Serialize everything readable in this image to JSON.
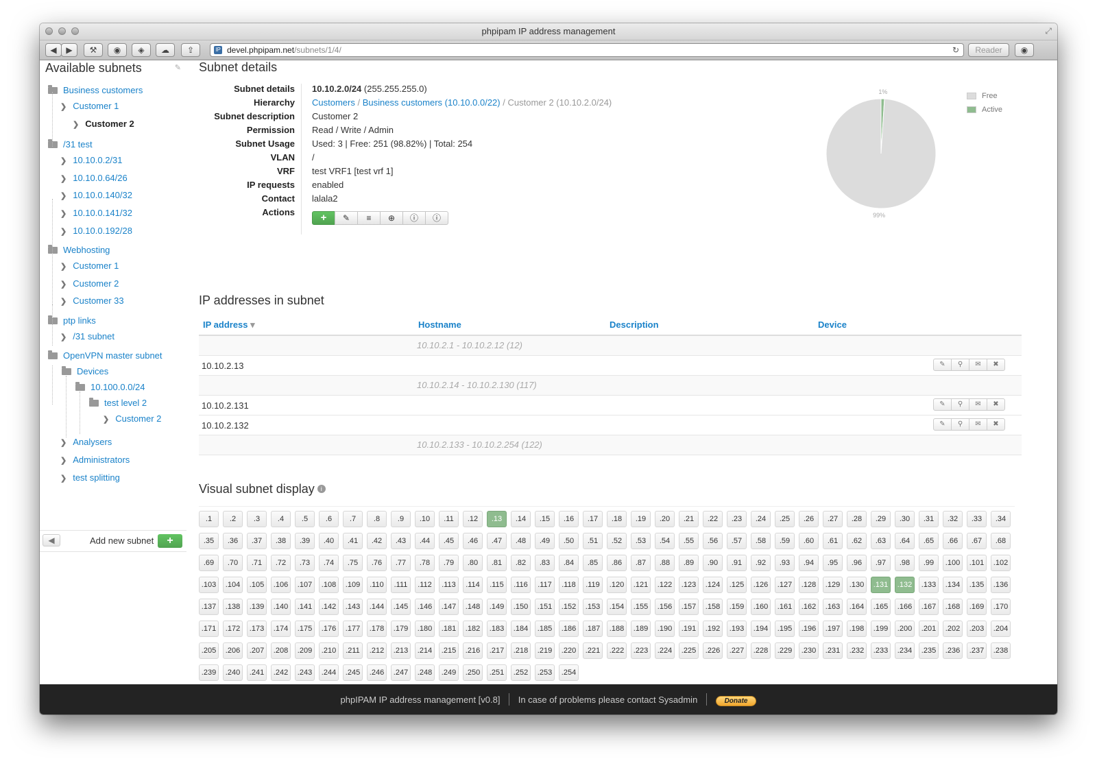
{
  "window": {
    "title": "phpipam IP address management"
  },
  "browser": {
    "url_host": "devel.phpipam.net",
    "url_path": "/subnets/1/4/",
    "reader_label": "Reader"
  },
  "sidebar": {
    "title": "Available subnets",
    "items": [
      {
        "label": "Business customers",
        "type": "folder"
      },
      {
        "label": "Customer 1",
        "type": "leaf"
      },
      {
        "label": "Customer 2",
        "type": "leaf",
        "active": true
      },
      {
        "label": "/31 test",
        "type": "folder"
      },
      {
        "label": "10.10.0.2/31",
        "type": "leaf"
      },
      {
        "label": "10.10.0.64/26",
        "type": "leaf"
      },
      {
        "label": "10.10.0.140/32",
        "type": "leaf"
      },
      {
        "label": "10.10.0.141/32",
        "type": "leaf"
      },
      {
        "label": "10.10.0.192/28",
        "type": "leaf"
      },
      {
        "label": "Webhosting",
        "type": "folder"
      },
      {
        "label": "Customer 1",
        "type": "leaf"
      },
      {
        "label": "Customer 2",
        "type": "leaf"
      },
      {
        "label": "Customer 33",
        "type": "leaf"
      },
      {
        "label": "ptp links",
        "type": "folder"
      },
      {
        "label": "/31 subnet",
        "type": "leaf"
      },
      {
        "label": "OpenVPN master subnet",
        "type": "folder"
      },
      {
        "label": "Devices",
        "type": "folder"
      },
      {
        "label": "10.100.0.0/24",
        "type": "folder"
      },
      {
        "label": "test level 2",
        "type": "folder"
      },
      {
        "label": "Customer 2",
        "type": "leaf"
      },
      {
        "label": "Analysers",
        "type": "leaf"
      },
      {
        "label": "Administrators",
        "type": "leaf"
      },
      {
        "label": "test splitting",
        "type": "leaf"
      }
    ],
    "add_label": "Add new subnet",
    "add_icon": "+"
  },
  "details": {
    "title": "Subnet details",
    "subnet_key": "Subnet details",
    "subnet_value_bold": "10.10.2.0/24",
    "subnet_value_mask": "(255.255.255.0)",
    "hierarchy_key": "Hierarchy",
    "hierarchy": [
      "Customers",
      "Business customers (10.10.0.0/22)",
      "Customer 2 (10.10.2.0/24)"
    ],
    "hierarchy_sep": "/",
    "rows": [
      {
        "key": "Subnet description",
        "value": "Customer 2"
      },
      {
        "key": "Permission",
        "value": "Read / Write / Admin"
      },
      {
        "key": "Subnet Usage",
        "value": "Used: 3 | Free: 251 (98.82%) | Total: 254"
      },
      {
        "key": "VLAN",
        "value": "/"
      },
      {
        "key": "VRF",
        "value": "test VRF1 [test vrf 1]"
      },
      {
        "key": "IP requests",
        "value": "enabled"
      },
      {
        "key": "Contact",
        "value": "lalala2"
      }
    ],
    "actions_key": "Actions",
    "actions": [
      "+",
      "✎",
      "≡",
      "⊕",
      "ⓘ",
      "ⓘ"
    ]
  },
  "chart_data": {
    "type": "pie",
    "labels": [
      "Free",
      "Active"
    ],
    "values": [
      99,
      1
    ],
    "slice_labels": [
      "99%",
      "1%"
    ],
    "colors": [
      "#dcdcdc",
      "#8fbc8f"
    ],
    "legend": "top-right"
  },
  "ip_section": {
    "title": "IP addresses in subnet",
    "headers": {
      "ip": "IP address",
      "hostname": "Hostname",
      "description": "Description",
      "device": "Device"
    },
    "sort_icon": "▾",
    "rows": [
      {
        "type": "range",
        "text": "10.10.2.1 - 10.10.2.12 (12)"
      },
      {
        "type": "ip",
        "text": "10.10.2.13"
      },
      {
        "type": "range",
        "text": "10.10.2.14 - 10.10.2.130 (117)"
      },
      {
        "type": "ip",
        "text": "10.10.2.131"
      },
      {
        "type": "ip",
        "text": "10.10.2.132"
      },
      {
        "type": "range",
        "text": "10.10.2.133 - 10.10.2.254 (122)"
      }
    ],
    "row_actions": [
      "✎",
      "⚲",
      "✉",
      "✖"
    ]
  },
  "visual": {
    "title": "Visual subnet display",
    "info_icon": "i",
    "first": 1,
    "last": 254,
    "used": [
      13,
      131,
      132
    ]
  },
  "footer": {
    "app": "phpIPAM IP address management [v0.8]",
    "contact": "In case of problems please contact Sysadmin",
    "donate": "Donate"
  }
}
